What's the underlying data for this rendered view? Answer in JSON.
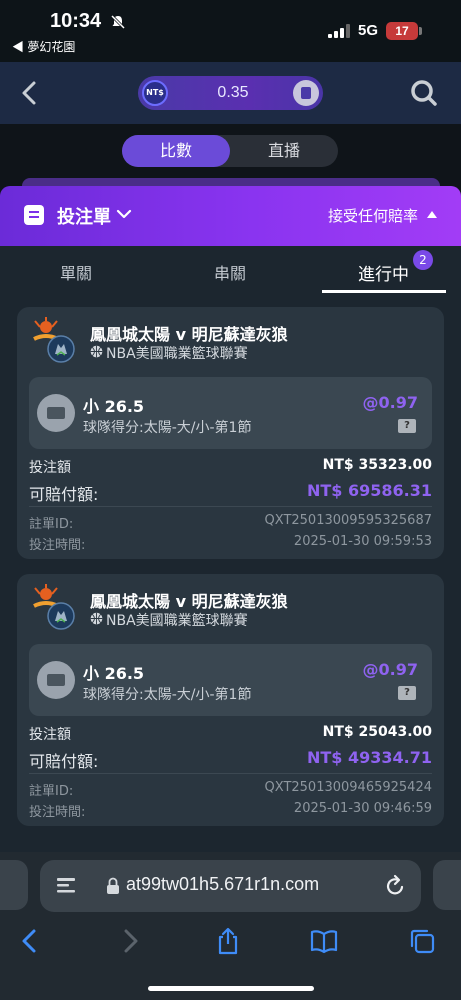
{
  "status_bar": {
    "time": "10:34",
    "back_app": "◀ 夢幻花園",
    "network": "5G",
    "battery": "17"
  },
  "top_nav": {
    "currency_badge": "NT$",
    "balance": "0.35"
  },
  "segment": {
    "active": "比數",
    "inactive": "直播"
  },
  "betslip": {
    "title": "投注單",
    "odds_option": "接受任何賠率"
  },
  "tabs": {
    "single": "單關",
    "parlay": "串關",
    "in_progress": "進行中",
    "in_progress_count": "2"
  },
  "bets": [
    {
      "match": "鳳凰城太陽 v 明尼蘇達灰狼",
      "league": "NBA美國職業籃球聯賽",
      "pick": "小 26.5",
      "market": "球隊得分:太陽-大/小-第1節",
      "odds": "@0.97",
      "stake_label": "投注額",
      "stake": "NT$ 35323.00",
      "payout_label": "可賠付額:",
      "payout": "NT$ 69586.31",
      "id_label": "註單ID:",
      "id": "QXT25013009595325687",
      "time_label": "投注時間:",
      "time": "2025-01-30 09:59:53"
    },
    {
      "match": "鳳凰城太陽 v 明尼蘇達灰狼",
      "league": "NBA美國職業籃球聯賽",
      "pick": "小 26.5",
      "market": "球隊得分:太陽-大/小-第1節",
      "odds": "@0.97",
      "stake_label": "投注額",
      "stake": "NT$ 25043.00",
      "payout_label": "可賠付額:",
      "payout": "NT$ 49334.71",
      "id_label": "註單ID:",
      "id": "QXT25013009465925424",
      "time_label": "投注時間:",
      "time": "2025-01-30 09:46:59"
    }
  ],
  "browser": {
    "url": "at99tw01h5.671r1n.com"
  },
  "colors": {
    "accent_purple": "#8f63f0",
    "header_gradient_start": "#6b2bd8",
    "header_gradient_end": "#a23cf6",
    "card_bg": "#2a3640",
    "battery_red": "#c63a3a"
  },
  "icons": [
    "bell-slash-icon",
    "signal-icon",
    "back-chevron-icon",
    "search-icon",
    "receipt-icon",
    "chevron-down-icon",
    "ticket-icon",
    "basketball-icon",
    "lock-icon",
    "reload-icon",
    "share-icon",
    "book-icon",
    "tabs-icon"
  ]
}
